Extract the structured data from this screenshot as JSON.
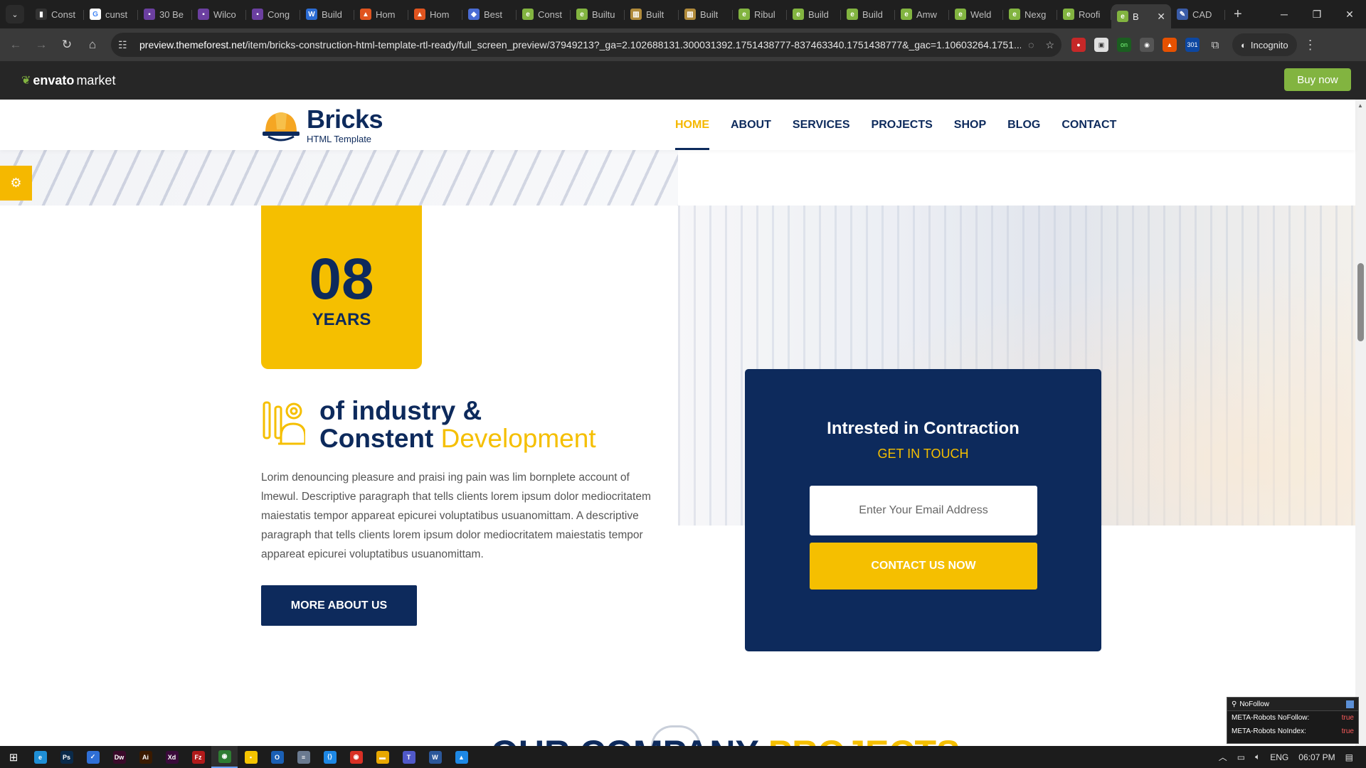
{
  "browser": {
    "tabs": [
      {
        "label": "Const",
        "color": "#333333",
        "glyph": "▮"
      },
      {
        "label": "cunst",
        "color": "#ffffff",
        "glyph": "G"
      },
      {
        "label": "30 Be",
        "color": "#6b3fa0",
        "glyph": "▪"
      },
      {
        "label": "Wilco",
        "color": "#6b3fa0",
        "glyph": "▪"
      },
      {
        "label": "Cong",
        "color": "#6b3fa0",
        "glyph": "▪"
      },
      {
        "label": "Build",
        "color": "#2b6cd4",
        "glyph": "W"
      },
      {
        "label": "Hom",
        "color": "#e0541f",
        "glyph": "▲"
      },
      {
        "label": "Hom",
        "color": "#e0541f",
        "glyph": "▲"
      },
      {
        "label": "Best",
        "color": "#4a6cd4",
        "glyph": "◆"
      },
      {
        "label": "Const",
        "color": "#82b440",
        "glyph": "e"
      },
      {
        "label": "Builtu",
        "color": "#82b440",
        "glyph": "e"
      },
      {
        "label": "Built",
        "color": "#b08a3a",
        "glyph": "▥"
      },
      {
        "label": "Built",
        "color": "#b08a3a",
        "glyph": "▥"
      },
      {
        "label": "Ribul",
        "color": "#82b440",
        "glyph": "e"
      },
      {
        "label": "Build",
        "color": "#82b440",
        "glyph": "e"
      },
      {
        "label": "Build",
        "color": "#82b440",
        "glyph": "e"
      },
      {
        "label": "Amw",
        "color": "#82b440",
        "glyph": "e"
      },
      {
        "label": "Weld",
        "color": "#82b440",
        "glyph": "e"
      },
      {
        "label": "Nexg",
        "color": "#82b440",
        "glyph": "e"
      },
      {
        "label": "Roofi",
        "color": "#82b440",
        "glyph": "e"
      }
    ],
    "active_tab": {
      "label": "B",
      "color": "#82b440",
      "glyph": "e"
    },
    "last_tab": {
      "label": "CAD",
      "color": "#3a5ca8",
      "glyph": "✎"
    },
    "url_host": "preview.themeforest.net",
    "url_path": "/item/bricks-construction-html-template-rtl-ready/full_screen_preview/37949213?_ga=2.102688131.300031392.1751438777-837463340.1751438777&_gac=1.10603264.1751...",
    "incognito_label": "Incognito",
    "ext_badge": "301"
  },
  "envato": {
    "logo_bold": "envato",
    "logo_rest": "market",
    "buy_now": "Buy now"
  },
  "site": {
    "brand": "Bricks",
    "brand_sub": "HTML Template",
    "nav": [
      "HOME",
      "ABOUT",
      "SERVICES",
      "PROJECTS",
      "SHOP",
      "BLOG",
      "CONTACT"
    ],
    "active_nav": "HOME"
  },
  "about": {
    "years_number": "08",
    "years_label": "YEARS",
    "heading_line1": "of industry &",
    "heading_line2_a": "Constent",
    "heading_line2_b": "Development",
    "paragraph": "Lorim denouncing pleasure and praisi ing pain was lim bornplete account of lmewul. Descriptive paragraph that tells clients lorem ipsum dolor mediocritatem maiestatis tempor appareat epicurei voluptatibus usuanomittam. A descriptive paragraph that tells clients lorem ipsum dolor mediocritatem maiestatis tempor appareat epicurei voluptatibus usuanomittam.",
    "button": "MORE ABOUT US"
  },
  "contact_card": {
    "title": "Intrested in Contraction",
    "subtitle": "GET IN TOUCH",
    "email_placeholder": "Enter Your Email Address",
    "button": "CONTACT US NOW"
  },
  "next_section": {
    "heading_a": "OUR COMPANY",
    "heading_b": "PROJECTS"
  },
  "nofollow_panel": {
    "title": "NoFollow",
    "rows": [
      {
        "label": "META-Robots NoFollow:",
        "value": "true"
      },
      {
        "label": "META-Robots NoIndex:",
        "value": "true"
      }
    ]
  },
  "taskbar": {
    "apps": [
      {
        "name": "edge",
        "color": "#1f8fd6",
        "glyph": "e"
      },
      {
        "name": "photoshop",
        "color": "#0a2a4a",
        "glyph": "Ps"
      },
      {
        "name": "todo",
        "color": "#2f6fd6",
        "glyph": "✓"
      },
      {
        "name": "dreamweaver",
        "color": "#3a0a2a",
        "glyph": "Dw"
      },
      {
        "name": "illustrator",
        "color": "#3a1a00",
        "glyph": "Ai"
      },
      {
        "name": "xd",
        "color": "#3a0a3a",
        "glyph": "Xd"
      },
      {
        "name": "filezilla",
        "color": "#b01a1a",
        "glyph": "Fz"
      },
      {
        "name": "chrome",
        "color": "#2e7d32",
        "glyph": "◉"
      },
      {
        "name": "sticky-notes",
        "color": "#f5c400",
        "glyph": "▪"
      },
      {
        "name": "outlook",
        "color": "#1a5fb4",
        "glyph": "O"
      },
      {
        "name": "notepad",
        "color": "#6a7a90",
        "glyph": "≡"
      },
      {
        "name": "vscode",
        "color": "#1e88e5",
        "glyph": "⟨⟩"
      },
      {
        "name": "chrome-2",
        "color": "#d93025",
        "glyph": "◉"
      },
      {
        "name": "explorer",
        "color": "#e8a800",
        "glyph": "▬"
      },
      {
        "name": "teams",
        "color": "#5059c9",
        "glyph": "T"
      },
      {
        "name": "word",
        "color": "#2b579a",
        "glyph": "W"
      },
      {
        "name": "photos",
        "color": "#1e88e5",
        "glyph": "▲"
      }
    ],
    "language": "ENG",
    "time": "06:07 PM"
  }
}
